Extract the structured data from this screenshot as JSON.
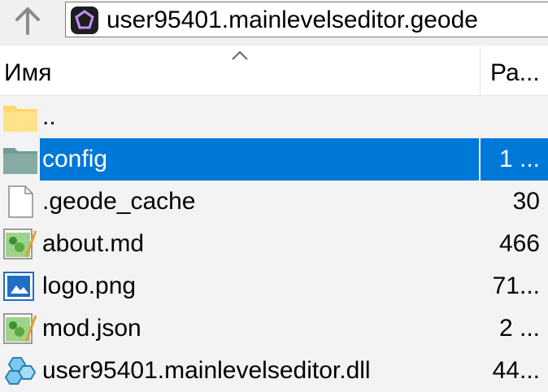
{
  "toolbar": {
    "up_icon": "arrow-up-icon",
    "address_icon": "pentagon-app-icon",
    "address_text": "user95401.mainlevelseditor.geode"
  },
  "columns": {
    "name_label": "Имя",
    "size_label": "Ра...",
    "sort_icon": "chevron-up-icon"
  },
  "colors": {
    "selection": "#0078d7",
    "folder": "#ffd86b",
    "background": "#f3f3f3"
  },
  "files": [
    {
      "name": "..",
      "size": "",
      "icon": "folder-icon"
    },
    {
      "name": "config",
      "size": "1 ...",
      "icon": "folder-icon",
      "selected": true
    },
    {
      "name": ".geode_cache",
      "size": "30",
      "icon": "blank-file-icon"
    },
    {
      "name": "about.md",
      "size": "466",
      "icon": "notepad-file-icon"
    },
    {
      "name": "logo.png",
      "size": "71...",
      "icon": "image-file-icon"
    },
    {
      "name": "mod.json",
      "size": "2 ...",
      "icon": "notepad-file-icon"
    },
    {
      "name": "user95401.mainlevelseditor.dll",
      "size": "44...",
      "icon": "dll-gears-icon"
    }
  ]
}
